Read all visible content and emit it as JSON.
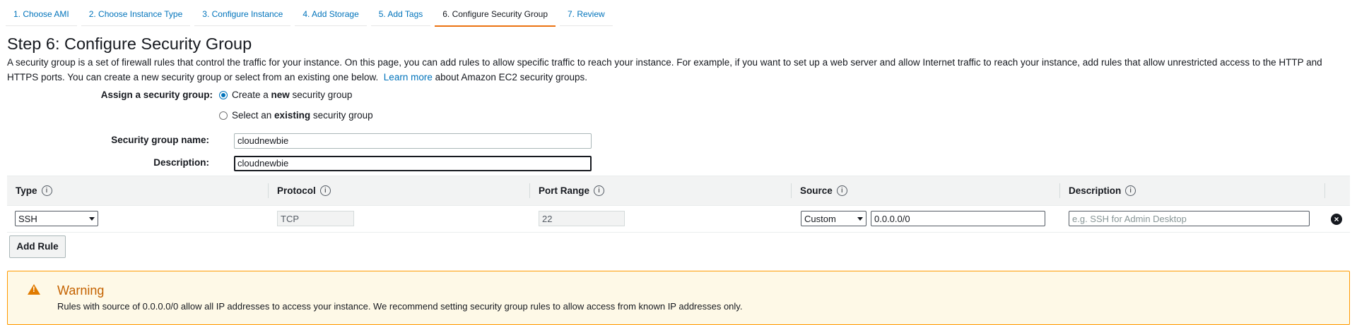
{
  "tabs": [
    {
      "label": "1. Choose AMI"
    },
    {
      "label": "2. Choose Instance Type"
    },
    {
      "label": "3. Configure Instance"
    },
    {
      "label": "4. Add Storage"
    },
    {
      "label": "5. Add Tags"
    },
    {
      "label": "6. Configure Security Group"
    },
    {
      "label": "7. Review"
    }
  ],
  "active_tab": "6. Configure Security Group",
  "page": {
    "title": "Step 6: Configure Security Group",
    "intro_text": "A security group is a set of firewall rules that control the traffic for your instance. On this page, you can add rules to allow specific traffic to reach your instance. For example, if you want to set up a web server and allow Internet traffic to reach your instance, add rules that allow unrestricted access to the HTTP and HTTPS ports. You can create a new security group or select from an existing one below.",
    "learn_more": "Learn more",
    "intro_suffix": "about Amazon EC2 security groups."
  },
  "form": {
    "assign_label": "Assign a security group:",
    "option_new": {
      "pre": "Create a ",
      "bold": "new",
      "post": " security group",
      "selected": true
    },
    "option_existing": {
      "pre": "Select an ",
      "bold": "existing",
      "post": " security group",
      "selected": false
    },
    "name_label": "Security group name:",
    "name_value": "cloudnewbie",
    "description_label": "Description:",
    "description_value": "cloudnewbie"
  },
  "rules": {
    "headers": {
      "type": "Type",
      "protocol": "Protocol",
      "port_range": "Port Range",
      "source": "Source",
      "description": "Description"
    },
    "info_glyph": "i",
    "rows": [
      {
        "type": "SSH",
        "protocol": "TCP",
        "port_range": "22",
        "source_mode": "Custom",
        "source_cidr": "0.0.0.0/0",
        "description_placeholder": "e.g. SSH for Admin Desktop"
      }
    ]
  },
  "add_rule_label": "Add Rule",
  "warning": {
    "title": "Warning",
    "text": "Rules with source of 0.0.0.0/0 allow all IP addresses to access your instance. We recommend setting security group rules to allow access from known IP addresses only."
  },
  "colors": {
    "link": "#0073bb",
    "active_tab_underline": "#ec7211",
    "warning_border": "#ff9900",
    "warning_title": "#c46200"
  }
}
